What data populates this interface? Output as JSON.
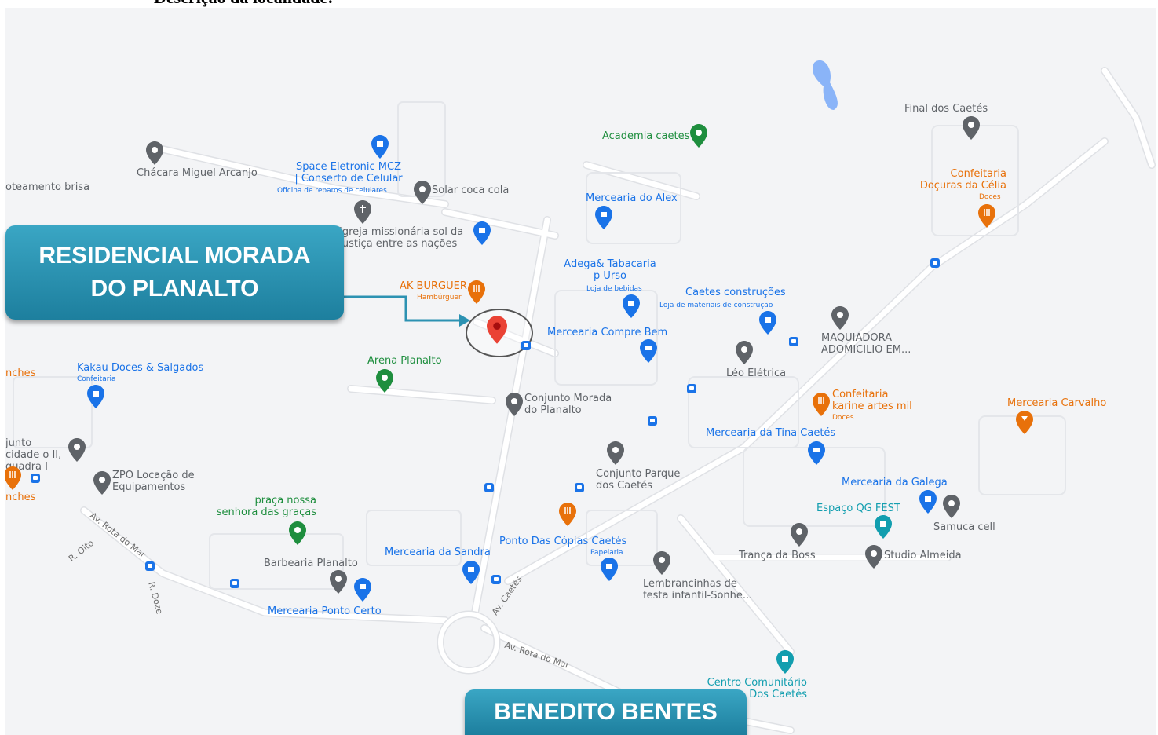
{
  "doc_heading": "Descrição da localidade:",
  "callouts": {
    "main": "RESIDENCIAL MORADA\nDO PLANALTO",
    "bottom": "BENEDITO BENTES"
  },
  "colors": {
    "map_bg": "#f3f4f6",
    "road": "#ffffff",
    "road_edge": "#dadce0",
    "blue_poi": "#1a73e8",
    "grey_poi": "#5f6368",
    "orange_poi": "#e8710a",
    "green_poi": "#1e8e3e",
    "teal_poi": "#129eaf",
    "red_pin": "#ea4335",
    "callout": "#2c92b2"
  },
  "places": [
    {
      "name": "Chácara Miguel Arcanjo",
      "sub": "",
      "icon": "grey"
    },
    {
      "name": "oteamento brisa",
      "sub": "",
      "icon": "none"
    },
    {
      "name": "Space Eletronic MCZ | Conserto de Celular",
      "sub": "Oficina de reparos de celulares",
      "icon": "blue"
    },
    {
      "name": "Solar coca cola",
      "sub": "",
      "icon": "grey"
    },
    {
      "name": "Igreja missionária sol da Justiça entre as nações",
      "sub": "",
      "icon": "grey"
    },
    {
      "name": "AK BURGUER",
      "sub": "Hambúrguer",
      "icon": "orange"
    },
    {
      "name": "Arena Planalto",
      "sub": "",
      "icon": "green"
    },
    {
      "name": "Kakau Doces & Salgados",
      "sub": "Confeitaria",
      "icon": "blue"
    },
    {
      "name": "Conjunto Morada do Planalto",
      "sub": "",
      "icon": "grey"
    },
    {
      "name": "Academia caetes",
      "sub": "",
      "icon": "green"
    },
    {
      "name": "Mercearia do Alex",
      "sub": "",
      "icon": "blue"
    },
    {
      "name": "Adega& Tabacaria p Urso",
      "sub": "Loja de bebidas",
      "icon": "blue"
    },
    {
      "name": "Caetes construções",
      "sub": "Loja de materiais de construção",
      "icon": "blue"
    },
    {
      "name": "Mercearia Compre Bem",
      "sub": "",
      "icon": "blue"
    },
    {
      "name": "Léo Elétrica",
      "sub": "",
      "icon": "grey"
    },
    {
      "name": "MAQUIADORA ADOMICILIO EM...",
      "sub": "",
      "icon": "grey"
    },
    {
      "name": "Final dos Caetés",
      "sub": "",
      "icon": "grey"
    },
    {
      "name": "Confeitaria Doçuras da Célia",
      "sub": "Doces",
      "icon": "orange"
    },
    {
      "name": "Confeitaria karine artes mil",
      "sub": "Doces",
      "icon": "orange"
    },
    {
      "name": "Mercearia Carvalho",
      "sub": "",
      "icon": "orange"
    },
    {
      "name": "Mercearia da Tina Caetés",
      "sub": "",
      "icon": "blue"
    },
    {
      "name": "Conjunto Parque dos Caetés",
      "sub": "",
      "icon": "grey"
    },
    {
      "name": "Mercearia da Galega",
      "sub": "",
      "icon": "blue"
    },
    {
      "name": "Espaço QG FEST",
      "sub": "",
      "icon": "teal"
    },
    {
      "name": "Samuca cell",
      "sub": "",
      "icon": "grey"
    },
    {
      "name": "Trança da Boss",
      "sub": "",
      "icon": "grey"
    },
    {
      "name": "Studio Almeida",
      "sub": "",
      "icon": "grey"
    },
    {
      "name": "junto cidade o II, quadra I",
      "sub": "",
      "icon": "grey"
    },
    {
      "name": "ZPO Locação de Equipamentos",
      "sub": "",
      "icon": "grey"
    },
    {
      "name": "praça nossa senhora das graças",
      "sub": "",
      "icon": "green"
    },
    {
      "name": "Barbearia Planalto",
      "sub": "",
      "icon": "grey"
    },
    {
      "name": "Mercearia Ponto Certo",
      "sub": "",
      "icon": "blue"
    },
    {
      "name": "Mercearia da Sandra",
      "sub": "",
      "icon": "blue"
    },
    {
      "name": "Ponto Das Cópias Caetés",
      "sub": "Papelaria",
      "icon": "blue"
    },
    {
      "name": "Lembrancinhas de festa infantil-Sonhe...",
      "sub": "",
      "icon": "grey"
    },
    {
      "name": "Centro Comunitário Dos Caetés",
      "sub": "",
      "icon": "teal"
    },
    {
      "name": "nches",
      "sub": "",
      "icon": "none"
    },
    {
      "name": "nches",
      "sub": "",
      "icon": "none"
    }
  ],
  "roads": [
    {
      "name": "Av. Rota do Mar"
    },
    {
      "name": "R. Oito"
    },
    {
      "name": "R. Doze"
    },
    {
      "name": "Av. Caetés"
    },
    {
      "name": "Av. Rota do Mar"
    }
  ]
}
